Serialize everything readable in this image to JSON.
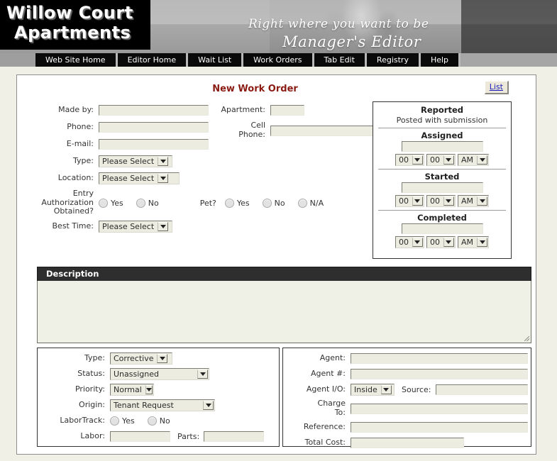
{
  "banner": {
    "logo_line1": "Willow Court",
    "logo_line2": "Apartments",
    "tagline": "Right where you want to be",
    "subtitle": "Manager's Editor"
  },
  "nav": {
    "items": [
      {
        "label": "Web Site Home"
      },
      {
        "label": "Editor Home"
      },
      {
        "label": "Wait List"
      },
      {
        "label": "Work Orders"
      },
      {
        "label": "Tab Edit"
      },
      {
        "label": "Registry"
      },
      {
        "label": "Help"
      }
    ]
  },
  "page": {
    "title": "New Work Order",
    "list_button": "List"
  },
  "form": {
    "made_by_label": "Made by:",
    "made_by_value": "",
    "phone_label": "Phone:",
    "phone_value": "",
    "email_label": "E-mail:",
    "email_value": "",
    "type_label": "Type:",
    "type_value": "Please Select",
    "location_label": "Location:",
    "location_value": "Please Select",
    "entry_auth_label_1": "Entry",
    "entry_auth_label_2": "Authorization",
    "entry_auth_label_3": "Obtained?",
    "entry_yes": "Yes",
    "entry_no": "No",
    "best_time_label": "Best Time:",
    "best_time_value": "Please Select",
    "apartment_label": "Apartment:",
    "apartment_value": "",
    "cell_phone_label_1": "Cell",
    "cell_phone_label_2": "Phone:",
    "cell_phone_value": "",
    "pet_label": "Pet?",
    "pet_yes": "Yes",
    "pet_no": "No",
    "pet_na": "N/A"
  },
  "reported": {
    "title": "Reported",
    "subtitle": "Posted with submission",
    "blocks": [
      {
        "title": "Assigned",
        "date_value": "",
        "hour": "00",
        "minute": "00",
        "meridiem": "AM"
      },
      {
        "title": "Started",
        "date_value": "",
        "hour": "00",
        "minute": "00",
        "meridiem": "AM"
      },
      {
        "title": "Completed",
        "date_value": "",
        "hour": "00",
        "minute": "00",
        "meridiem": "AM"
      }
    ]
  },
  "description": {
    "header": "Description",
    "value": ""
  },
  "work_detail": {
    "type_label": "Type:",
    "type_value": "Corrective",
    "status_label": "Status:",
    "status_value": "Unassigned",
    "priority_label": "Priority:",
    "priority_value": "Normal",
    "origin_label": "Origin:",
    "origin_value": "Tenant Request",
    "labortrack_label": "LaborTrack:",
    "labortrack_yes": "Yes",
    "labortrack_no": "No",
    "labor_label": "Labor:",
    "labor_value": "",
    "parts_label": "Parts:",
    "parts_value": ""
  },
  "agent_detail": {
    "agent_label": "Agent:",
    "agent_value": "",
    "agent_num_label": "Agent #:",
    "agent_num_value": "",
    "agent_io_label": "Agent I/O:",
    "agent_io_value": "Inside",
    "source_label": "Source:",
    "source_value": "",
    "charge_to_label_1": "Charge",
    "charge_to_label_2": "To:",
    "charge_to_value": "",
    "reference_label": "Reference:",
    "reference_value": "",
    "total_cost_label": "Total Cost:",
    "total_cost_value": ""
  },
  "colors": {
    "title_red": "#8b1a12",
    "link_blue": "#1a1ab8",
    "input_fill": "#ecece0",
    "page_bg": "#f1f0e7",
    "nav_bg": "#0a0a0a"
  }
}
